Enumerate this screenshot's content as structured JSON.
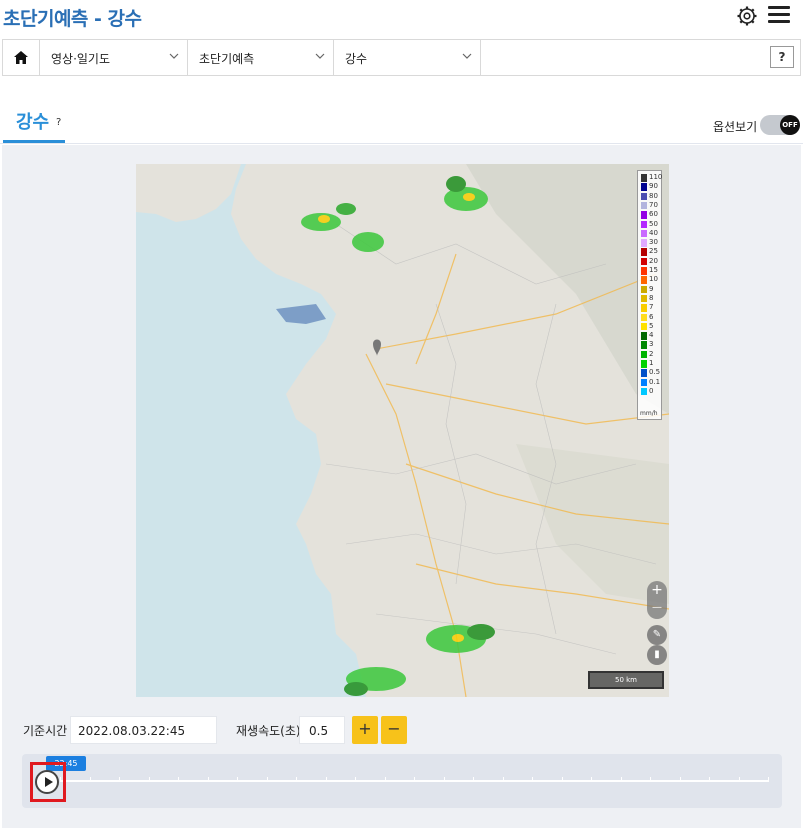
{
  "header": {
    "title": "초단기예측 - 강수",
    "settings_icon": "gear-icon",
    "menu_icon": "hamburger-menu-icon"
  },
  "breadcrumb": {
    "home_icon": "home-icon",
    "items": [
      {
        "label": "영상·일기도"
      },
      {
        "label": "초단기예측"
      },
      {
        "label": "강수"
      }
    ],
    "help_label": "?"
  },
  "tabs": {
    "active": {
      "label": "강수",
      "help": "?"
    }
  },
  "options": {
    "label": "옵션보기",
    "toggle_state": "OFF"
  },
  "map": {
    "legend": {
      "levels": [
        "110",
        "90",
        "80",
        "70",
        "60",
        "50",
        "40",
        "30",
        "25",
        "20",
        "15",
        "10",
        "9",
        "8",
        "7",
        "6",
        "5",
        "4",
        "3",
        "2",
        "1",
        "0.5",
        "0.1",
        "0"
      ],
      "colors": [
        "#333333",
        "#000390",
        "#4c4eb1",
        "#b3b4de",
        "#9300e4",
        "#b329ff",
        "#c969ff",
        "#e0a9ff",
        "#b40000",
        "#d20000",
        "#ff3300",
        "#ff6600",
        "#ccaa00",
        "#e0b900",
        "#f9cd00",
        "#ffdc1f",
        "#ffe100",
        "#006900",
        "#008800",
        "#00b400",
        "#00d200",
        "#0050c8",
        "#0080ff",
        "#00c8ff"
      ],
      "unit": "mm/h"
    },
    "scale_label": "50 km",
    "zoom_in": "+",
    "zoom_out": "—",
    "ruler_icon": "ruler-icon",
    "layers_icon": "map-layers-icon"
  },
  "controls": {
    "base_time_label": "기준시간",
    "base_time_value": "2022.08.03.22:45",
    "speed_label": "재생속도(초)",
    "speed_value": "0.5",
    "plus_label": "+",
    "minus_label": "−"
  },
  "timeline": {
    "current_time": "22:45",
    "play_icon": "play-icon"
  },
  "colors": {
    "title": "#2a6fb5",
    "accent": "#2a8fd8",
    "button_yellow": "#f7c21a",
    "timeline_badge": "#1b7fe0",
    "highlight_red": "#e0191f"
  }
}
